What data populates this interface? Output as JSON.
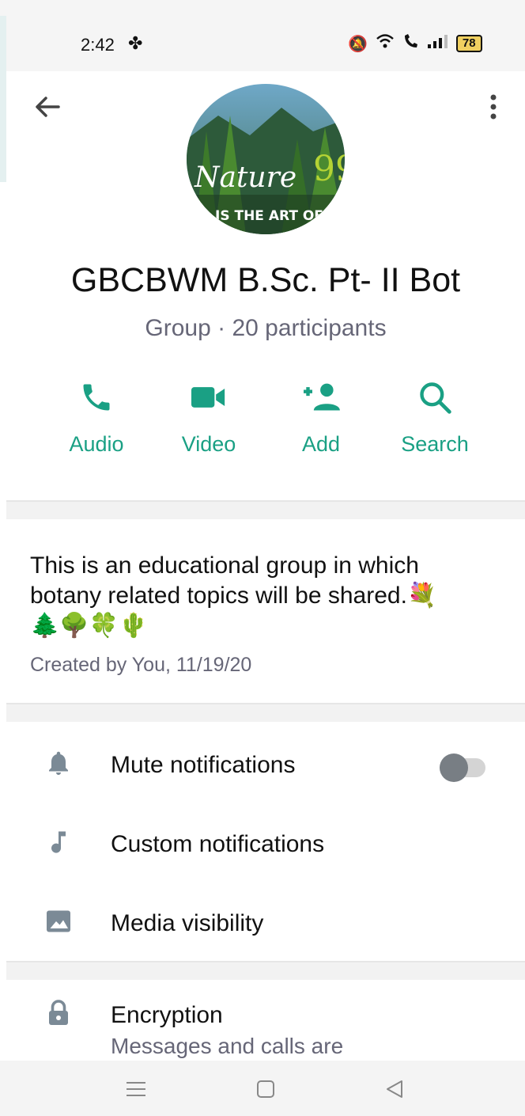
{
  "status_bar": {
    "time": "2:42",
    "battery": "78"
  },
  "group": {
    "name": "GBCBWM B.Sc. Pt- II Bot",
    "subtitle": "Group · 20 participants",
    "avatar_text_main": "Nature",
    "avatar_text_sub": "IS THE ART OF G"
  },
  "actions": [
    {
      "label": "Audio"
    },
    {
      "label": "Video"
    },
    {
      "label": "Add"
    },
    {
      "label": "Search"
    }
  ],
  "description": {
    "line1": "This is an educational group in which",
    "line2": "botany related topics will be shared.💐",
    "line3": "🌲🌳🍀🌵",
    "created": "Created by You, 11/19/20"
  },
  "settings": [
    {
      "label": "Mute notifications",
      "icon": "bell-icon"
    },
    {
      "label": "Custom notifications",
      "icon": "music-note-icon"
    },
    {
      "label": "Media visibility",
      "icon": "image-icon"
    }
  ],
  "encryption": {
    "label": "Encryption",
    "sub": "Messages and calls are"
  },
  "colors": {
    "accent": "#1aa084",
    "icon_gray": "#7b8a96"
  }
}
